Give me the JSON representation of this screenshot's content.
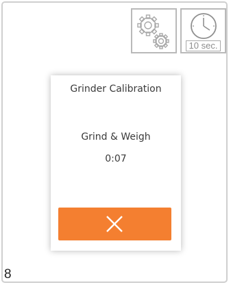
{
  "toolbar": {
    "settings_icon": "gears-icon",
    "timer_icon": "clock-icon",
    "timer_label": "10 sec."
  },
  "dialog": {
    "title": "Grinder Calibration",
    "status_label": "Grind & Weigh",
    "timer_value": "0:07",
    "cancel_icon": "close-icon",
    "accent_color": "#f47f30"
  },
  "footer": {
    "page_number": "8"
  }
}
